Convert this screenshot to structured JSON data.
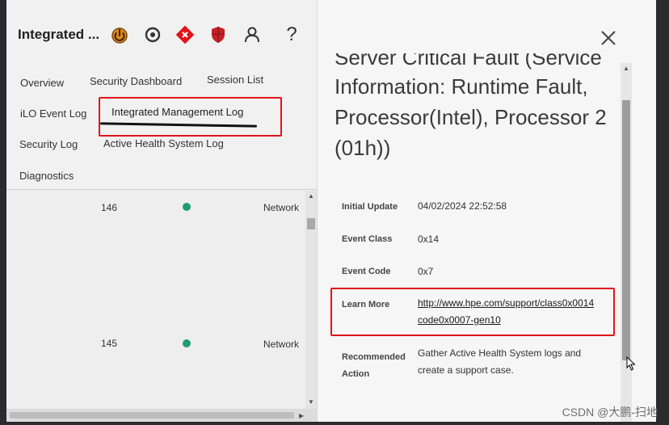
{
  "app": {
    "title": "Integrated ..."
  },
  "toolbar": {
    "icons": [
      "power-icon",
      "location-icon",
      "health-status-icon",
      "security-shield-icon",
      "user-icon",
      "help-icon"
    ],
    "power_color": "#e08a1e",
    "health_color": "#e0141a",
    "shield_color": "#c6202a"
  },
  "nav": {
    "overview": "Overview",
    "security_dashboard": "Security Dashboard",
    "session_list": "Session List",
    "ilo_event_log": "iLO Event Log",
    "integrated_management_log": "Integrated Management Log",
    "security_log": "Security Log",
    "active_health_system_log": "Active Health System Log",
    "diagnostics": "Diagnostics"
  },
  "log_rows": [
    {
      "id": "146",
      "status_color": "#1f9e6c",
      "category": "Network"
    },
    {
      "id": "145",
      "status_color": "#1f9e6c",
      "category": "Network"
    }
  ],
  "detail": {
    "title_partial": "Server Critical Fault (Service",
    "title_rest_1": "Information: Runtime Fault,",
    "title_rest_2": "Processor(Intel), Processor 2",
    "title_rest_3": "(01h))",
    "initial_update_label": "Initial Update",
    "initial_update_value": "04/02/2024 22:52:58",
    "event_class_label": "Event Class",
    "event_class_value": "0x14",
    "event_code_label": "Event Code",
    "event_code_value": "0x7",
    "learn_more_label": "Learn More",
    "learn_more_line1": "http://www.hpe.com/support/class0x0014",
    "learn_more_line2": "code0x0007-gen10",
    "recommended_label_1": "Recommended",
    "recommended_label_2": "Action",
    "recommended_value_1": "Gather Active Health System logs and",
    "recommended_value_2": "create a support case."
  },
  "highlight_color": "#e0141a",
  "watermark": "CSDN @大鹏-扫地"
}
